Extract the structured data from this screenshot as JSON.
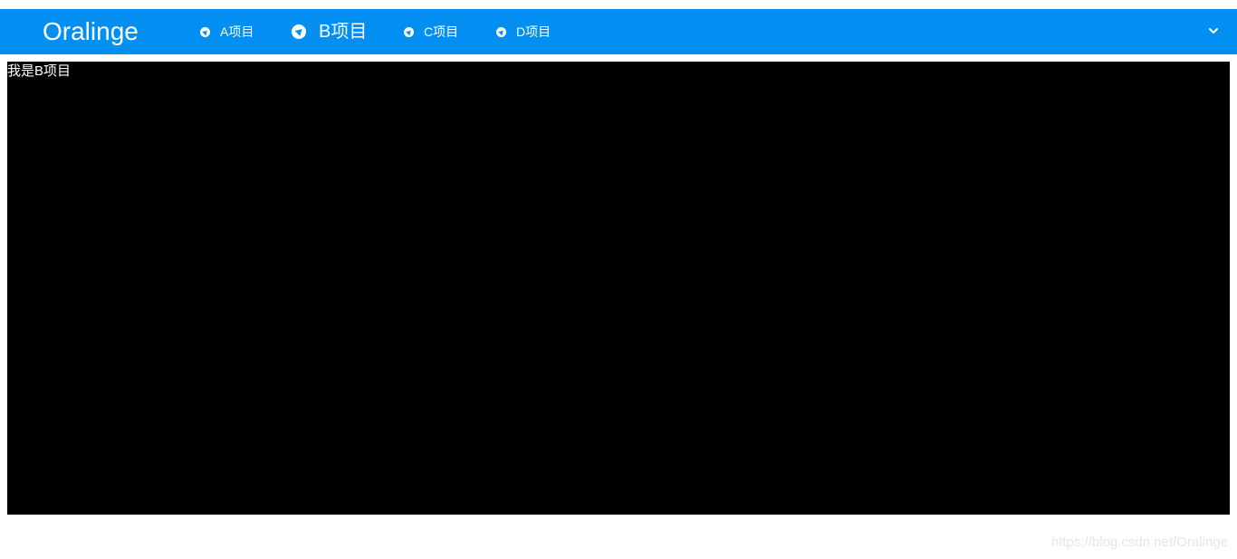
{
  "header": {
    "brand": "Oralinge",
    "background_color": "#038ff1",
    "nav_items": [
      {
        "label": "A项目",
        "icon": "compass-icon",
        "active": false
      },
      {
        "label": "B项目",
        "icon": "compass-icon",
        "active": true
      },
      {
        "label": "C项目",
        "icon": "compass-icon",
        "active": false
      },
      {
        "label": "D项目",
        "icon": "compass-icon",
        "active": false
      }
    ],
    "menu_toggle_icon": "chevron-down-icon"
  },
  "main": {
    "text": "我是B项目",
    "background_color": "#000000"
  },
  "watermark": "https://blog.csdn.net/Oralinge"
}
